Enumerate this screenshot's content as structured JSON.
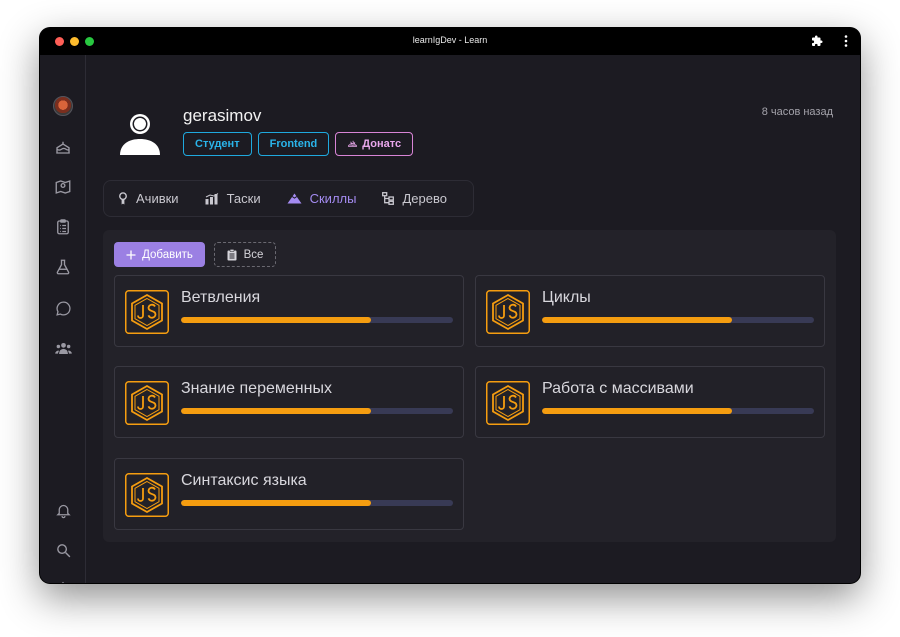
{
  "window": {
    "title": "learnIgDev - Learn"
  },
  "profile": {
    "username": "gerasimov",
    "last_seen": "8 часов назад",
    "badges": [
      {
        "label": "Студент"
      },
      {
        "label": "Frontend"
      },
      {
        "label": "Донатс",
        "icon": "donut-icon"
      }
    ]
  },
  "tabs": [
    {
      "label": "Ачивки",
      "icon": "award-icon"
    },
    {
      "label": "Таски",
      "icon": "tasks-chart-icon"
    },
    {
      "label": "Скиллы",
      "icon": "mountain-icon",
      "active": true
    },
    {
      "label": "Дерево",
      "icon": "tree-icon"
    }
  ],
  "toolbar": {
    "add_label": "Добавить",
    "all_label": "Все"
  },
  "skills": [
    {
      "name": "Ветвления",
      "progress": 0.7
    },
    {
      "name": "Циклы",
      "progress": 0.7
    },
    {
      "name": "Знание переменных",
      "progress": 0.7
    },
    {
      "name": "Работа с массивами",
      "progress": 0.7
    },
    {
      "name": "Синтаксис языка",
      "progress": 0.7
    }
  ],
  "sidebar": {
    "top_icons": [
      "user-avatar",
      "cake-icon",
      "map-marker-icon",
      "clipboard-icon",
      "flask-icon",
      "chat-icon",
      "users-icon"
    ],
    "bottom_icons": [
      "bell-icon",
      "search-icon",
      "settings-icon"
    ]
  },
  "colors": {
    "accent": "#9b80e3",
    "progress": "#f59d10",
    "badge_blue": "#1fa9de",
    "badge_pink": "#d884d6"
  }
}
